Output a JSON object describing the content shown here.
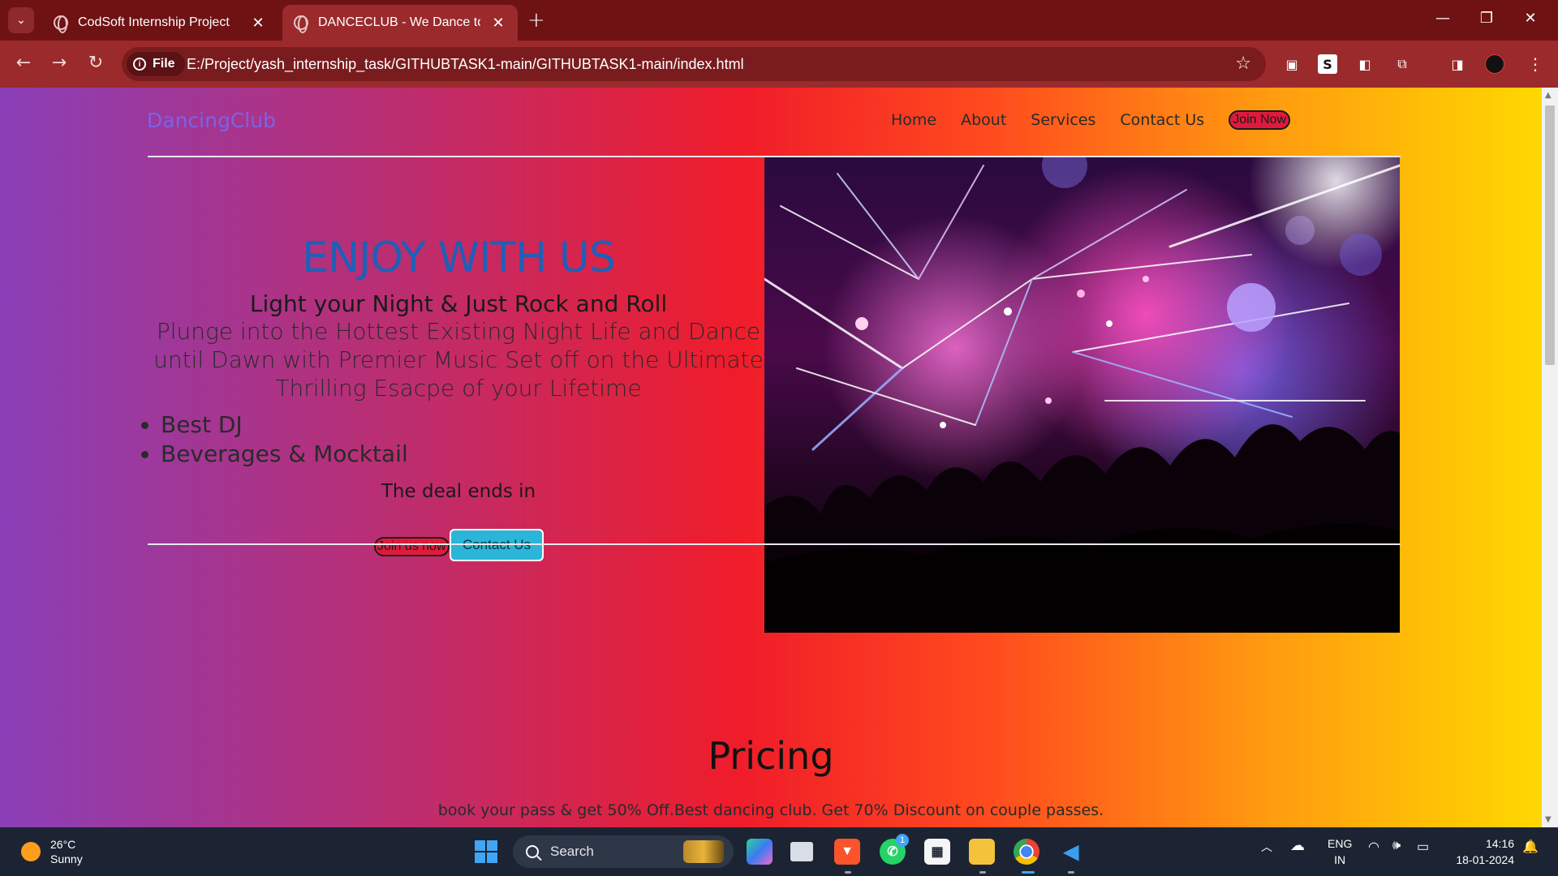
{
  "browser": {
    "tabs": [
      {
        "title": "CodSoft Internship Project",
        "active": false
      },
      {
        "title": "DANCECLUB - We Dance to Exp",
        "active": true
      }
    ],
    "new_tab_label": "+",
    "minimize": "—",
    "restore": "❐",
    "close": "✕",
    "back": "←",
    "forward": "→",
    "reload": "↻",
    "chip_label": "File",
    "url": "E:/Project/yash_internship_task/GITHUBTASK1-main/GITHUBTASK1-main/index.html",
    "bookmark": "☆",
    "menu": "⋮",
    "colors": {
      "tabbar": "#6f1214",
      "toolbar": "#9a2a2c"
    }
  },
  "site": {
    "logo": "DancingClub",
    "nav": [
      "Home",
      "About",
      "Services",
      "Contact Us"
    ],
    "nav_join": "Join Now",
    "hero": {
      "title": "ENJOY WITH US",
      "subtitle": "Light your Night & Just Rock and Roll",
      "description": "Plunge into the Hottest Existing Night Life and Dance until Dawn with Premier Music Set off on the Ultimate Thrilling Esacpe of your Lifetime",
      "bullets": [
        "Best DJ",
        "Beverages & Mocktail"
      ],
      "deal": "The deal ends in",
      "join_btn": "Join us now",
      "contact_btn": "Contact Us"
    },
    "pricing": {
      "title": "Pricing",
      "description": "book your pass & get 50% Off.Best dancing club. Get 70% Discount on couple passes."
    },
    "colors": {
      "logo": "#7a63e6",
      "hero_title": "#1f5fb8",
      "join": "#e01a3c",
      "contact": "#2bb5d8"
    }
  },
  "taskbar": {
    "temperature": "26°C",
    "condition": "Sunny",
    "search_label": "Search",
    "apps": [
      "copilot-icon",
      "task-view-icon",
      "brave-icon",
      "whatsapp-icon",
      "store-icon",
      "file-explorer-icon",
      "chrome-icon",
      "vscode-icon"
    ],
    "whatsapp_badge": "1",
    "lang_line1": "ENG",
    "lang_line2": "IN",
    "time": "14:16",
    "date": "18-01-2024"
  }
}
